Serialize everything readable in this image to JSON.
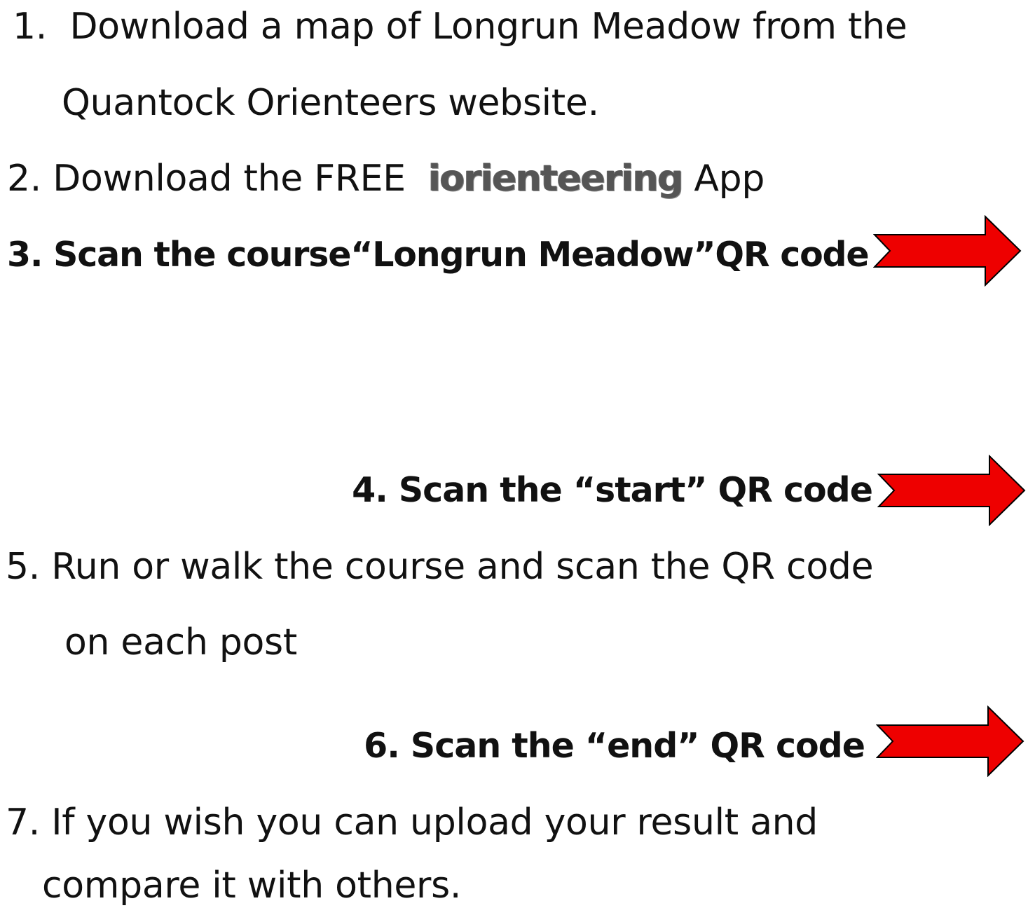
{
  "steps": [
    {
      "number": "1.",
      "line1": "Download a map of Longrun Meadow from the",
      "line2": "Quantock Orienteers website."
    },
    {
      "number": "2.",
      "prefix": "Download the FREE",
      "app_name": "iorienteering",
      "suffix": "App"
    },
    {
      "text": "3. Scan the course“Longrun Meadow”QR code"
    },
    {
      "text": "4. Scan the “start” QR code"
    },
    {
      "line1": "5. Run or walk the course and scan the QR code",
      "line2": "on each post"
    },
    {
      "text": "6. Scan the “end” QR code"
    },
    {
      "line1": "7. If you wish you can upload your result and",
      "line2": "compare it with others."
    }
  ],
  "colors": {
    "arrow_fill": "#ee0000",
    "arrow_stroke": "#000000",
    "app_name_text": "#555555"
  },
  "icons": {
    "pointer_arrow": "right-arrow-icon"
  }
}
